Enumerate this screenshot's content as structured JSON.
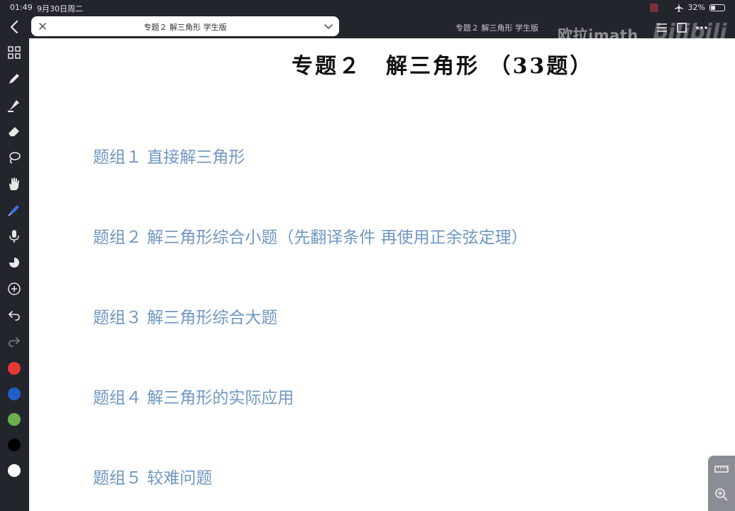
{
  "status_bar": {
    "time": "01:49",
    "date": "9月30日周二",
    "battery": "32%",
    "battery_level": 0.32
  },
  "nav": {
    "tab_title": "专题２ 解三角形 学生版",
    "doc_title_right": "专题２ 解三角形 学生版"
  },
  "watermark": {
    "channel": "欧拉imath",
    "brand": "bilibili"
  },
  "document": {
    "heading_part1": "专题２",
    "heading_part2": "解三角形 （33题）",
    "groups": [
      "题组１ 直接解三角形",
      "题组２ 解三角形综合小题（先翻译条件 再使用正余弦定理）",
      "题组３ 解三角形综合大题",
      "题组４ 解三角形的实际应用",
      "题组５ 较难问题"
    ]
  },
  "toolbar": {
    "tools": [
      "thumbnails-icon",
      "pen-icon",
      "highlighter-icon",
      "eraser-icon",
      "lasso-icon",
      "hand-icon",
      "fountain-pen-icon",
      "microphone-icon",
      "sticker-icon",
      "add-icon",
      "undo-icon",
      "redo-icon"
    ],
    "colors": [
      "#e53935",
      "#1e5ec8",
      "#6ab04c",
      "#000000",
      "#ffffff"
    ]
  },
  "colors": {
    "group_text": "#6f97c4",
    "app_background": "#23252d"
  }
}
